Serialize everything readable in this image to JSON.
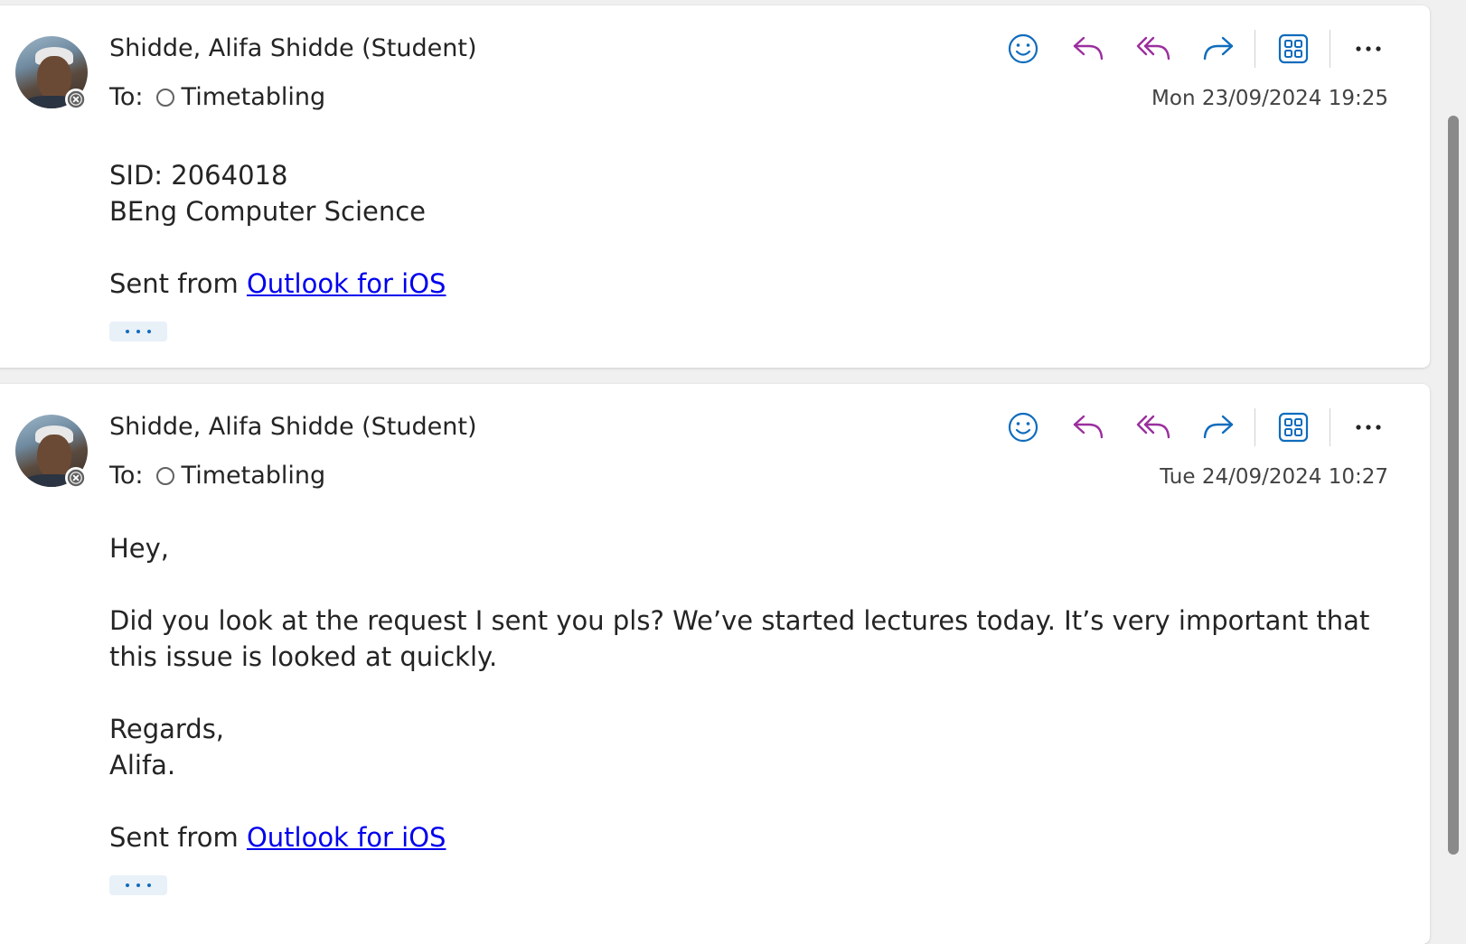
{
  "messages": [
    {
      "sender": "Shidde, Alifa Shidde (Student)",
      "to_label": "To:",
      "recipient": "Timetabling",
      "timestamp": "Mon 23/09/2024 19:25",
      "body": {
        "line1": "SID: 2064018",
        "line2": "BEng Computer Science",
        "sent_from_prefix": "Sent from ",
        "sent_from_link": "Outlook for iOS"
      }
    },
    {
      "sender": "Shidde, Alifa Shidde (Student)",
      "to_label": "To:",
      "recipient": "Timetabling",
      "timestamp": "Tue 24/09/2024 10:27",
      "body": {
        "greeting": "Hey,",
        "paragraph": "Did you look at the request I sent you pls? We’ve started lectures today. It’s very important that this issue is looked at quickly.",
        "regards": "Regards,",
        "signature": "Alifa.",
        "sent_from_prefix": "Sent from ",
        "sent_from_link": "Outlook for iOS"
      }
    }
  ],
  "toolbar_icons": [
    "emoji-react-icon",
    "reply-icon",
    "reply-all-icon",
    "forward-icon",
    "apps-icon",
    "more-options-icon"
  ],
  "colors": {
    "blue_icon": "#0f6cbd",
    "purple_icon": "#9b2f9e",
    "link": "#0000ee",
    "text": "#242424"
  }
}
